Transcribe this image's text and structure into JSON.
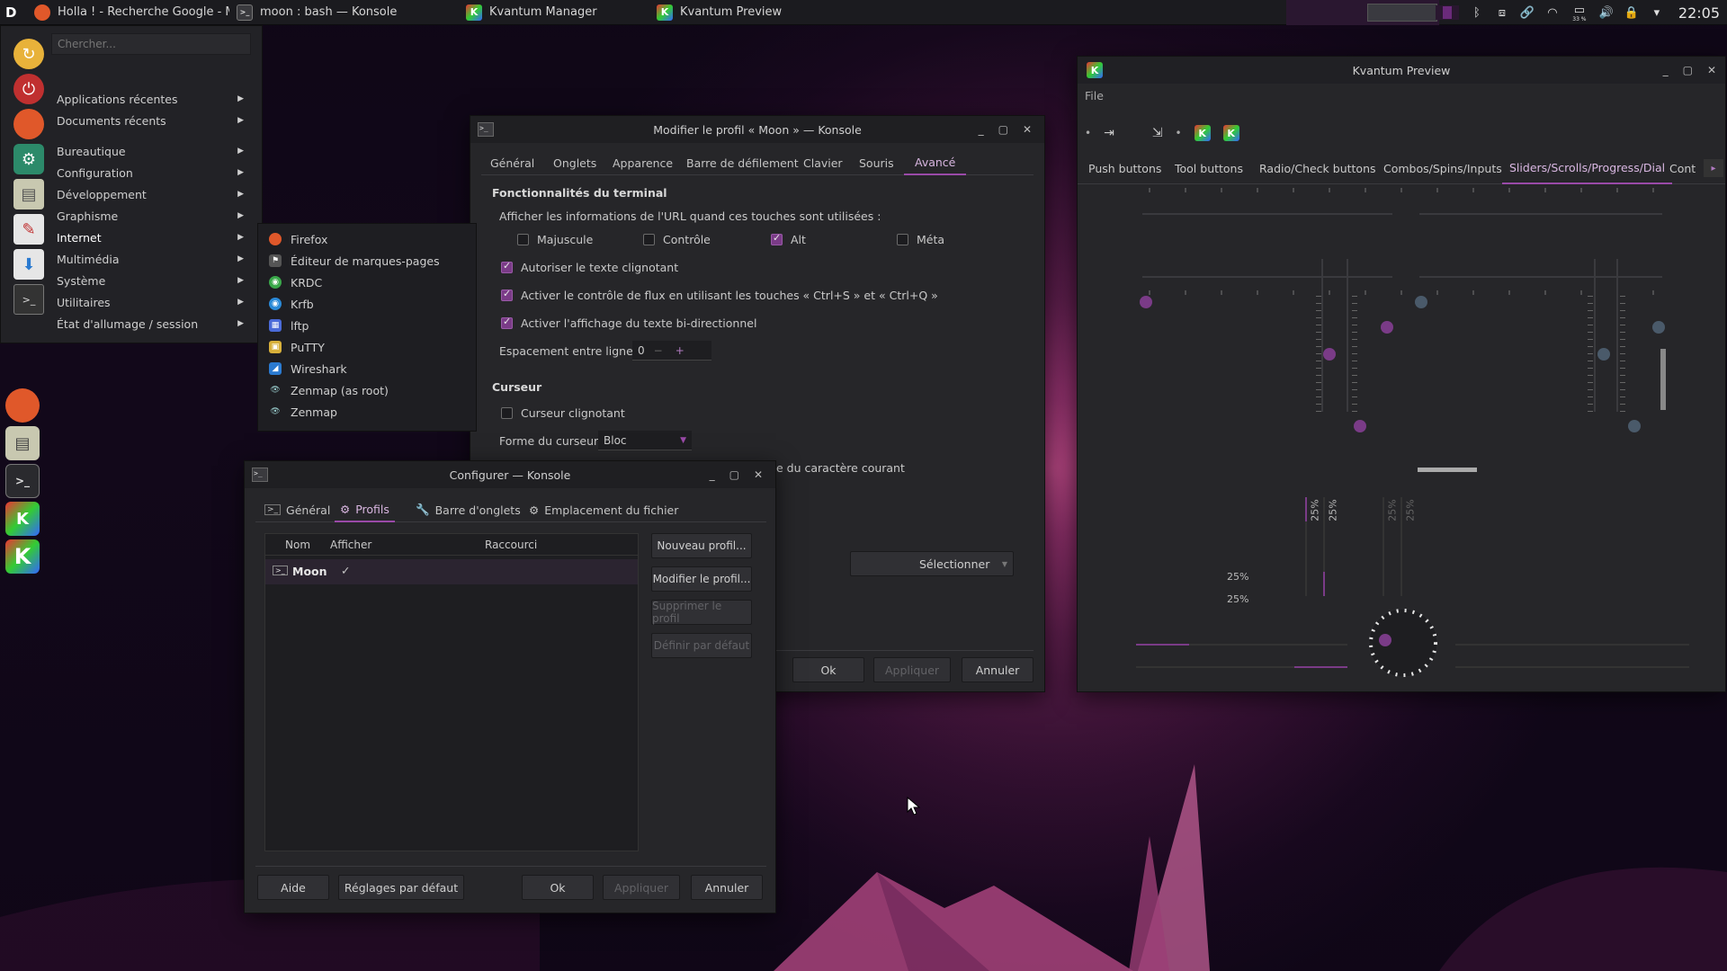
{
  "colors": {
    "accent": "#9a4aa8",
    "panel": "#1b1b1f",
    "window": "#262629"
  },
  "panel": {
    "tasks": [
      {
        "label": "Holla ! - Recherche Google - Mozill...",
        "icon": "firefox-icon"
      },
      {
        "label": "moon : bash — Konsole",
        "icon": "konsole-icon"
      },
      {
        "label": "Kvantum Manager",
        "icon": "kvantum-icon"
      },
      {
        "label": "Kvantum Preview",
        "icon": "kvantum-icon"
      }
    ],
    "battery": "33 %",
    "clock": "22:05"
  },
  "launcher": {
    "search_placeholder": "Chercher...",
    "categories": [
      "Applications récentes",
      "Documents récents",
      "Bureautique",
      "Configuration",
      "Développement",
      "Graphisme",
      "Internet",
      "Multimédia",
      "Système",
      "Utilitaires",
      "État d'allumage / session"
    ],
    "internet_apps": [
      "Firefox",
      "Éditeur de marques-pages",
      "KRDC",
      "Krfb",
      "lftp",
      "PuTTY",
      "Wireshark",
      "Zenmap (as root)",
      "Zenmap"
    ]
  },
  "profile_window": {
    "title": "Modifier le profil « Moon » — Konsole",
    "tabs": [
      "Général",
      "Onglets",
      "Apparence",
      "Barre de défilement",
      "Clavier",
      "Souris",
      "Avancé"
    ],
    "section_terminal": "Fonctionnalités du terminal",
    "url_hint": "Afficher les informations de l'URL quand ces touches sont utilisées :",
    "mod_keys": [
      {
        "label": "Majuscule",
        "checked": false
      },
      {
        "label": "Contrôle",
        "checked": false
      },
      {
        "label": "Alt",
        "checked": true
      },
      {
        "label": "Méta",
        "checked": false
      }
    ],
    "options": [
      {
        "label": "Autoriser le texte clignotant",
        "checked": true
      },
      {
        "label": "Activer le contrôle de flux en utilisant les touches « Ctrl+S » et « Ctrl+Q »",
        "checked": true
      },
      {
        "label": "Activer l'affichage du texte bi-directionnel",
        "checked": true
      }
    ],
    "line_spacing_label": "Espacement entre lignes :",
    "line_spacing_value": "0",
    "minus": "−",
    "plus": "+",
    "section_cursor": "Curseur",
    "cursor_blink": "Curseur clignotant",
    "cursor_shape_label": "Forme du curseur :",
    "cursor_shape_value": "Bloc",
    "char_color_text": "e du caractère courant",
    "select_label": "Sélectionner",
    "ok": "Ok",
    "apply": "Appliquer",
    "cancel": "Annuler"
  },
  "config_window": {
    "title": "Configurer — Konsole",
    "tabs": [
      "Général",
      "Profils",
      "Barre d'onglets",
      "Emplacement du fichier"
    ],
    "columns": [
      "Nom",
      "Afficher",
      "Raccourci"
    ],
    "rows": [
      {
        "name": "Moon",
        "show": "✓",
        "shortcut": ""
      }
    ],
    "side_buttons": [
      {
        "label": "Nouveau profil...",
        "enabled": true
      },
      {
        "label": "Modifier le profil...",
        "enabled": true
      },
      {
        "label": "Supprimer le profil",
        "enabled": false
      },
      {
        "label": "Définir par défaut",
        "enabled": false
      }
    ],
    "help": "Aide",
    "defaults": "Réglages par défaut",
    "ok": "Ok",
    "apply": "Appliquer",
    "cancel": "Annuler"
  },
  "kvantum": {
    "title": "Kvantum Preview",
    "menu_file": "File",
    "tabs": [
      "Push buttons",
      "Tool buttons",
      "Radio/Check buttons",
      "Combos/Spins/Inputs",
      "Sliders/Scrolls/Progress/Dial",
      "Cont"
    ],
    "progress_labels": [
      "25%",
      "25%",
      "25%",
      "25%",
      "25%",
      "25%"
    ],
    "progress_value": 0.25
  }
}
